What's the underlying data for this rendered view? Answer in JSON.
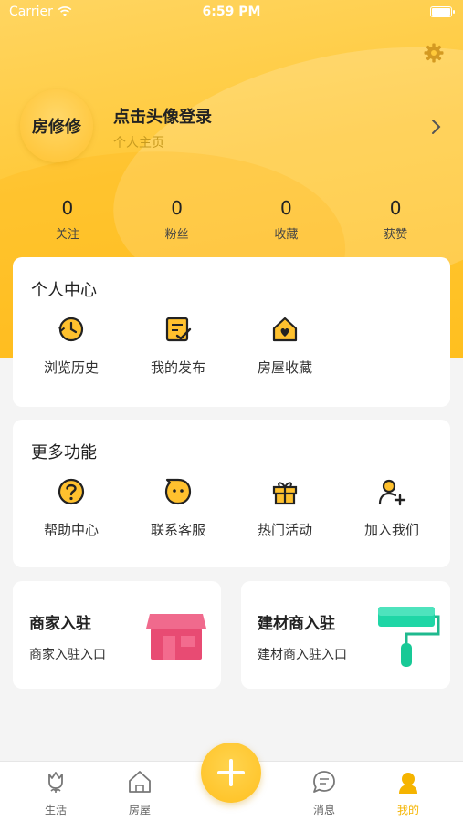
{
  "status_bar": {
    "carrier": "Carrier",
    "time": "6:59 PM"
  },
  "profile": {
    "avatar_text": "房修修",
    "login_prompt": "点击头像登录",
    "subtitle": "个人主页"
  },
  "stats": [
    {
      "value": "0",
      "label": "关注"
    },
    {
      "value": "0",
      "label": "粉丝"
    },
    {
      "value": "0",
      "label": "收藏"
    },
    {
      "value": "0",
      "label": "获赞"
    }
  ],
  "personal_center": {
    "title": "个人中心",
    "items": [
      {
        "label": "浏览历史",
        "icon": "history-icon"
      },
      {
        "label": "我的发布",
        "icon": "publish-icon"
      },
      {
        "label": "房屋收藏",
        "icon": "house-favorite-icon"
      }
    ]
  },
  "more_features": {
    "title": "更多功能",
    "items": [
      {
        "label": "帮助中心",
        "icon": "help-icon"
      },
      {
        "label": "联系客服",
        "icon": "customer-service-icon"
      },
      {
        "label": "热门活动",
        "icon": "gift-icon"
      },
      {
        "label": "加入我们",
        "icon": "add-user-icon"
      }
    ]
  },
  "promos": [
    {
      "title": "商家入驻",
      "subtitle": "商家入驻入口",
      "icon": "shop-icon"
    },
    {
      "title": "建材商入驻",
      "subtitle": "建材商入驻入口",
      "icon": "paint-roller-icon"
    }
  ],
  "tabbar": {
    "tabs": [
      {
        "label": "生活",
        "icon": "tulip-icon"
      },
      {
        "label": "房屋",
        "icon": "home-icon"
      },
      {
        "label": "消息",
        "icon": "message-icon"
      },
      {
        "label": "我的",
        "icon": "profile-icon",
        "active": true
      }
    ]
  },
  "colors": {
    "accent": "#ffc12e",
    "active_tab": "#f5b400"
  }
}
